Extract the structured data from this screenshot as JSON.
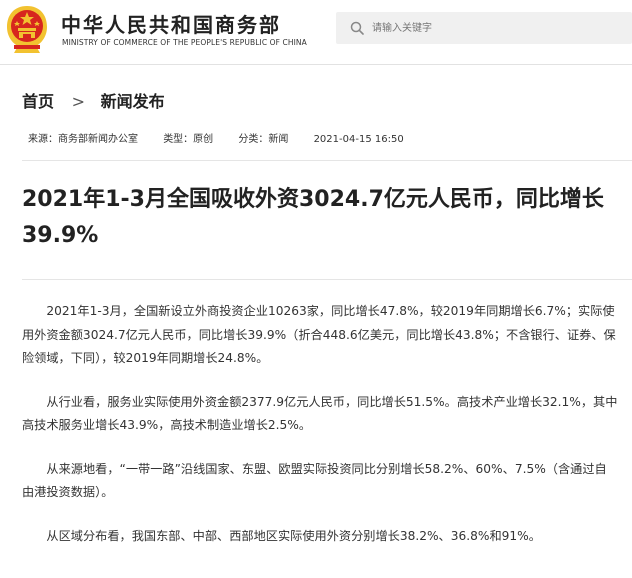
{
  "header": {
    "site_title": "中华人民共和国商务部",
    "site_subtitle": "MINISTRY OF COMMERCE OF THE PEOPLE'S REPUBLIC OF CHINA",
    "emblem_icon": "national-emblem-icon",
    "search_placeholder": "请输入关键字",
    "search_icon": "search-icon"
  },
  "breadcrumb": {
    "home": "首页",
    "separator": ">",
    "current": "新闻发布"
  },
  "meta": {
    "source": "来源：商务部新闻办公室",
    "type": "类型：原创",
    "category": "分类：新闻",
    "datetime": "2021-04-15 16:50"
  },
  "article": {
    "title": "2021年1-3月全国吸收外资3024.7亿元人民币，同比增长39.9%",
    "paragraphs": [
      "2021年1-3月，全国新设立外商投资企业10263家，同比增长47.8%，较2019年同期增长6.7%；实际使用外资金额3024.7亿元人民币，同比增长39.9%（折合448.6亿美元，同比增长43.8%；不含银行、证券、保险领域，下同），较2019年同期增长24.8%。",
      "从行业看，服务业实际使用外资金额2377.9亿元人民币，同比增长51.5%。高技术产业增长32.1%，其中高技术服务业增长43.9%，高技术制造业增长2.5%。",
      "从来源地看，“一带一路”沿线国家、东盟、欧盟实际投资同比分别增长58.2%、60%、7.5%（含通过自由港投资数据）。",
      "从区域分布看，我国东部、中部、西部地区实际使用外资分别增长38.2%、36.8%和91%。"
    ]
  },
  "colors": {
    "emblem_red": "#d7261e",
    "emblem_gold": "#f2c230",
    "text": "#333333",
    "search_bg": "#f0f0f0"
  }
}
